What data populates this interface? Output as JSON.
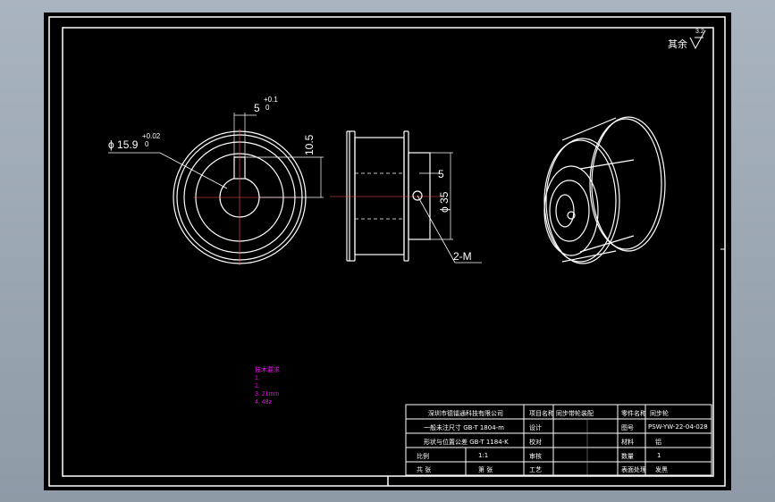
{
  "drawing": {
    "roughness_label": "其余",
    "roughness_value": "3.2",
    "front_view": {
      "bore_dimension": "ϕ 15.9",
      "bore_tol_upper": "+0.02",
      "bore_tol_lower": "0",
      "key_width": "5",
      "key_tol_upper": "+0.1",
      "key_tol_lower": "0",
      "key_depth": "10.5"
    },
    "side_view": {
      "hub_length": "5",
      "hub_diameter": "ϕ 35",
      "screw_callout": "2-M"
    },
    "tech_notes": [
      "技术要求",
      "1.",
      "2.",
      "3.  21mm",
      "4.  48z"
    ]
  },
  "title_block": {
    "company": "深圳市德镭通科技有限公司",
    "row2": "一般未注尺寸 GB-T 1804-m",
    "row3": "形状与位置公差 GB-T 1184-K",
    "row4_a": "比例",
    "row4_b": "1:1",
    "row5_a": "共  张",
    "row5_b": "第  张",
    "col2": [
      "设计",
      "校对",
      "审核",
      "批准",
      "工艺"
    ],
    "project_label": "项目名称",
    "project_value": "同步带轮装配",
    "name_label": "零件名称",
    "name_value": "同步轮",
    "code_label": "图号",
    "code_value": "PSW-YW-22-04-028",
    "material_label": "材料",
    "material_value": "铝",
    "qty_label": "数量",
    "qty_value": "1",
    "finish_label": "表面处理",
    "finish_value": "发黑"
  }
}
